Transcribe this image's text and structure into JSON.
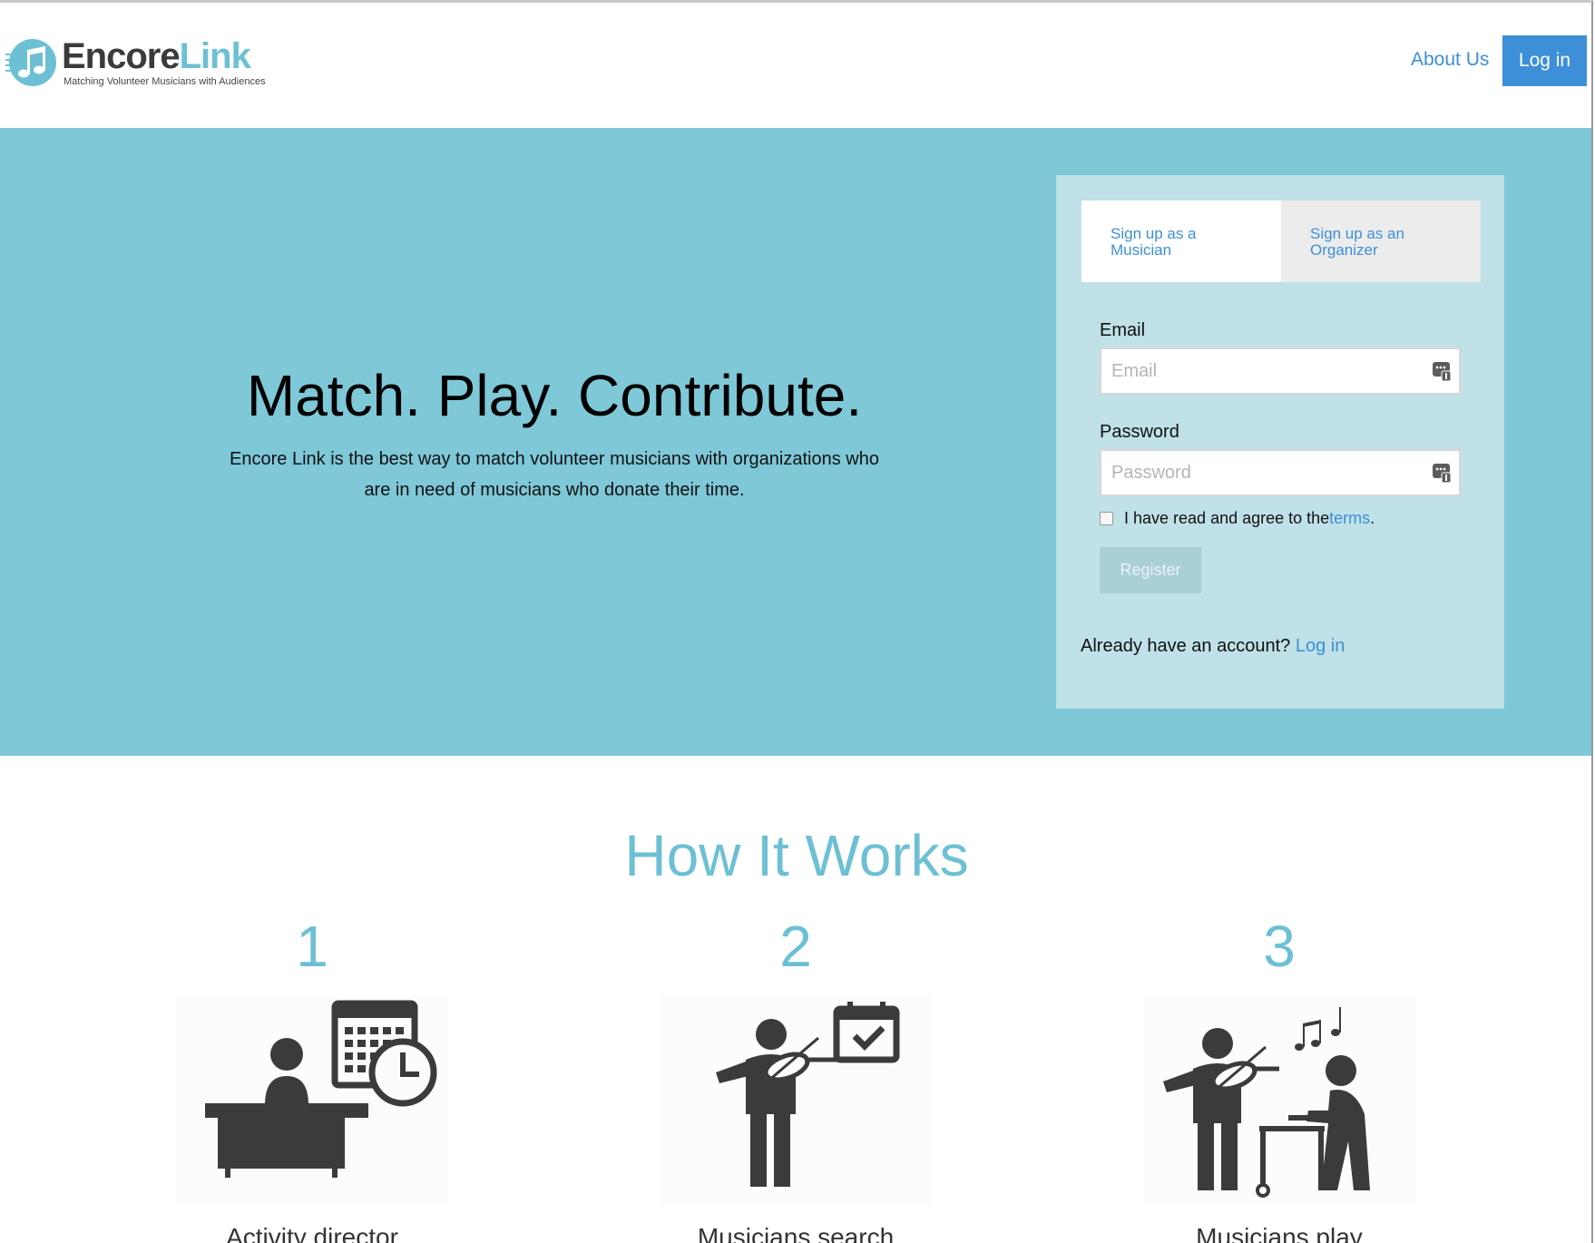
{
  "brand": {
    "name_part1": "Encore",
    "name_part2": "Link",
    "tagline": "Matching Volunteer Musicians with Audiences",
    "colors": {
      "accent": "#6dc0d4",
      "link": "#3d8fd8",
      "hero_bg": "#7ec8d8",
      "dark": "#3b3b3b"
    }
  },
  "nav": {
    "about_label": "About Us",
    "login_label": "Log in"
  },
  "hero": {
    "title": "Match. Play. Contribute.",
    "description": "Encore Link is the best way to match volunteer musicians with organizations who are in need of musicians who donate their time."
  },
  "signup": {
    "tabs": [
      {
        "label": "Sign up as a Musician",
        "active": true
      },
      {
        "label": "Sign up as an Organizer",
        "active": false
      }
    ],
    "email_label": "Email",
    "email_placeholder": "Email",
    "email_value": "",
    "password_label": "Password",
    "password_placeholder": "Password",
    "password_value": "",
    "terms_prefix": "I have read and agree to the ",
    "terms_link": "terms",
    "terms_suffix": ".",
    "terms_checked": false,
    "register_label": "Register",
    "already_text": "Already have an account? ",
    "already_link": "Log in",
    "field_icon": "password-manager-icon"
  },
  "how_it_works": {
    "title": "How It Works",
    "steps": [
      {
        "number": "1",
        "caption": "Activity director",
        "icon": "director-desk-calendar-icon"
      },
      {
        "number": "2",
        "caption": "Musicians search",
        "icon": "violinist-calendar-check-icon"
      },
      {
        "number": "3",
        "caption": "Musicians play",
        "icon": "violinist-elderly-walker-icon"
      }
    ]
  }
}
